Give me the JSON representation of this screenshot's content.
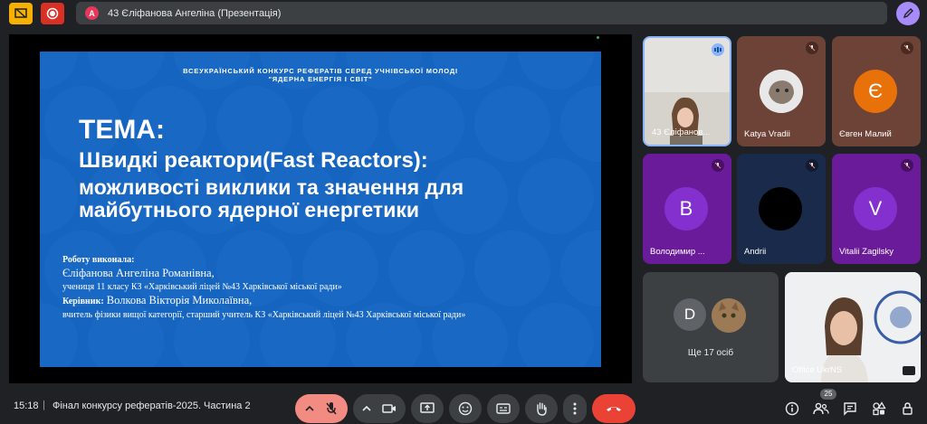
{
  "topbar": {
    "avatar_letter": "A",
    "window_title": "43 Єліфанова Ангеліна (Презентація)"
  },
  "slide": {
    "header_line1": "ВСЕУКРАЇНСЬКИЙ КОНКУРС РЕФЕРАТІВ СЕРЕД УЧНІВСЬКОЇ МОЛОДІ",
    "header_line2": "\"ЯДЕРНА ЕНЕРГІЯ І СВІТ\"",
    "tema": "ТЕМА:",
    "title": "Швидкі реактори(Fast Reactors):",
    "subtitle": "можливості виклики та значення для майбутнього ядерної енергетики",
    "author_label": "Роботу виконала:",
    "author_name": "Єліфанова Ангеліна Романівна,",
    "author_info": "учениця 11 класу  КЗ «Харківський ліцей №43 Харківської міської ради»",
    "supervisor_label": "Керівник:",
    "supervisor_name": " Волкова Вікторія Миколаївна,",
    "supervisor_info": "вчитель фізики вищої категорії, старший учитель КЗ «Харківський ліцей №43 Харківської міської ради»"
  },
  "participants": [
    {
      "name": "43 Єліфанов...",
      "kind": "video"
    },
    {
      "name": "Katya Vradii",
      "kind": "photo"
    },
    {
      "name": "Євген Малий",
      "letter": "Є",
      "color": "#e8710a"
    },
    {
      "name": "Володимир ...",
      "letter": "В",
      "color": "#8430ce"
    },
    {
      "name": "Andrii",
      "kind": "dark"
    },
    {
      "name": "Vitalii Zagilsky",
      "letter": "V",
      "color": "#8430ce"
    },
    {
      "name": "Office UkrNS",
      "kind": "video"
    }
  ],
  "more_tile": {
    "avatar_letter": "D",
    "label": "Ще 17 осіб"
  },
  "bottombar": {
    "time": "15:18",
    "separator": "|",
    "meeting_title": "Фінал конкурсу рефератів-2025. Частина 2",
    "people_count": "25"
  }
}
